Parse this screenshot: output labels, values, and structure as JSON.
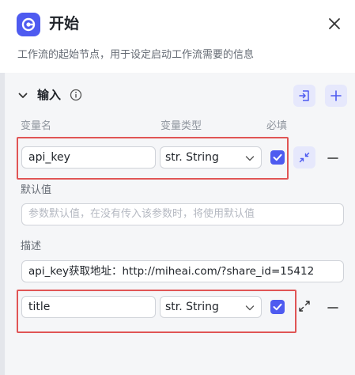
{
  "header": {
    "title": "开始",
    "description": "工作流的起始节点，用于设定启动工作流需要的信息"
  },
  "section": {
    "label": "输入"
  },
  "columns": {
    "name": "变量名",
    "type": "变量类型",
    "required": "必填"
  },
  "variables": [
    {
      "name": "api_key",
      "type": "str. String",
      "required": true,
      "default_label": "默认值",
      "default_placeholder": "参数默认值，在没有传入该参数时，将使用默认值",
      "desc_label": "描述",
      "desc_value": "api_key获取地址：http://miheai.com/?share_id=15412"
    },
    {
      "name": "title",
      "type": "str. String",
      "required": true
    }
  ],
  "colors": {
    "accent": "#4e5bf0",
    "accent_light": "#e6e8fc",
    "highlight": "#e05555"
  }
}
